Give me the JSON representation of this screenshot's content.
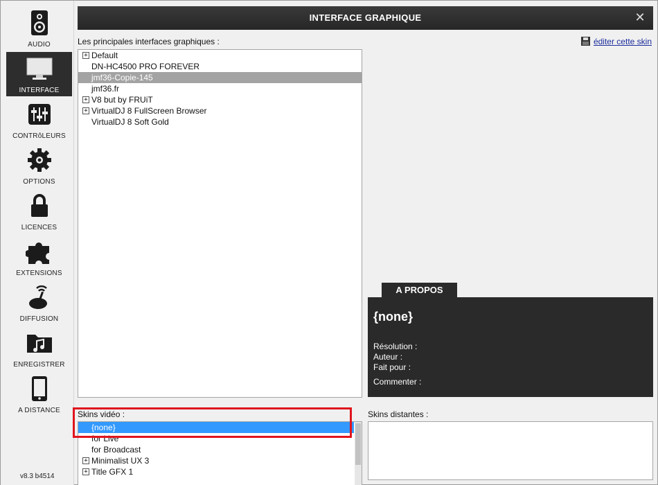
{
  "sidebar": {
    "items": [
      {
        "label": "AUDIO",
        "icon": "speaker-icon"
      },
      {
        "label": "INTERFACE",
        "icon": "monitor-icon",
        "active": true
      },
      {
        "label": "CONTRôLEURS",
        "icon": "sliders-icon"
      },
      {
        "label": "OPTIONS",
        "icon": "gear-icon"
      },
      {
        "label": "LICENCES",
        "icon": "lock-icon"
      },
      {
        "label": "EXTENSIONS",
        "icon": "puzzle-icon"
      },
      {
        "label": "DIFFUSION",
        "icon": "broadcast-icon"
      },
      {
        "label": "ENREGISTRER",
        "icon": "music-folder-icon"
      },
      {
        "label": "A DISTANCE",
        "icon": "phone-icon"
      }
    ],
    "version": "v8.3 b4514"
  },
  "titlebar": {
    "title": "INTERFACE GRAPHIQUE",
    "close": "✕"
  },
  "skins": {
    "label": "Les principales interfaces graphiques :",
    "items": [
      {
        "label": "Default",
        "expandable": true
      },
      {
        "label": "DN-HC4500 PRO FOREVER",
        "expandable": false
      },
      {
        "label": "jmf36-Copie-145",
        "expandable": false,
        "selected": true
      },
      {
        "label": "jmf36.fr",
        "expandable": false
      },
      {
        "label": "V8 but by FRUiT",
        "expandable": true
      },
      {
        "label": "VirtualDJ 8 FullScreen Browser",
        "expandable": true
      },
      {
        "label": "VirtualDJ 8 Soft Gold",
        "expandable": false
      }
    ]
  },
  "edit_skin": {
    "label": "éditer cette skin"
  },
  "about": {
    "tab": "A PROPOS",
    "name": "{none}",
    "resolution_label": "Résolution :",
    "author_label": "Auteur :",
    "made_for_label": "Fait pour :",
    "comment_label": "Commenter :"
  },
  "video_skins": {
    "label": "Skins vidéo :",
    "items": [
      {
        "label": "{none}",
        "expandable": false,
        "selected": true
      },
      {
        "label": "for Live",
        "expandable": false
      },
      {
        "label": "for Broadcast",
        "expandable": false
      },
      {
        "label": "Minimalist UX 3",
        "expandable": true
      },
      {
        "label": "Title GFX 1",
        "expandable": true
      }
    ]
  },
  "remote_skins": {
    "label": "Skins distantes :"
  },
  "colors": {
    "accent_red": "#e0141e",
    "select_blue": "#3399ff",
    "dark_panel": "#2a2a2a"
  }
}
